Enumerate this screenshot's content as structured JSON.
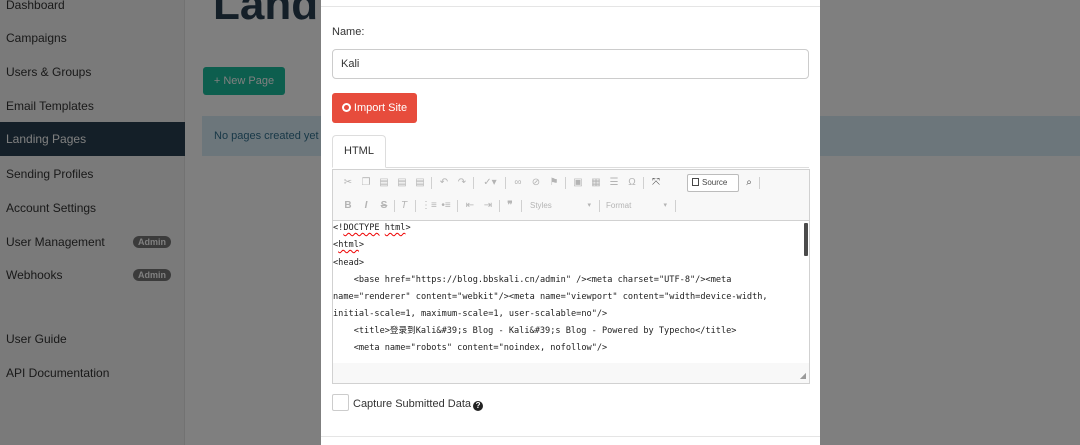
{
  "sidebar": {
    "items": [
      {
        "label": "Dashboard"
      },
      {
        "label": "Campaigns"
      },
      {
        "label": "Users & Groups"
      },
      {
        "label": "Email Templates"
      },
      {
        "label": "Landing Pages",
        "active": true
      },
      {
        "label": "Sending Profiles"
      },
      {
        "label": "Account Settings"
      },
      {
        "label": "User Management",
        "badge": "Admin"
      },
      {
        "label": "Webhooks",
        "badge": "Admin"
      },
      {
        "label": "User Guide"
      },
      {
        "label": "API Documentation"
      }
    ]
  },
  "main": {
    "title": "Landi",
    "new_page_label": "+ New Page",
    "empty_message": "No pages created yet"
  },
  "modal": {
    "name_label": "Name:",
    "name_value": "Kali",
    "import_label": "Import Site",
    "tab_label": "HTML",
    "toolbar": {
      "source_label": "Source",
      "styles_label": "Styles",
      "format_label": "Format"
    },
    "code_lines": [
      "<!DOCTYPE html>",
      "<html>",
      "<head>",
      "    <base href=\"https://blog.bbskali.cn/admin\" /><meta charset=\"UTF-8\"/><meta",
      "name=\"renderer\" content=\"webkit\"/><meta name=\"viewport\" content=\"width=device-width,",
      "initial-scale=1, maximum-scale=1, user-scalable=no\"/>",
      "    <title>登录到Kali&#39;s Blog - Kali&#39;s Blog - Powered by Typecho</title>",
      "    <meta name=\"robots\" content=\"noindex, nofollow\"/>"
    ],
    "capture_label": "Capture Submitted Data",
    "capture_checked": false
  },
  "colors": {
    "accent": "#1abc9c",
    "import_button": "#e74c3c",
    "sidebar_active": "#283f50",
    "info_bg": "#d9edf7"
  }
}
